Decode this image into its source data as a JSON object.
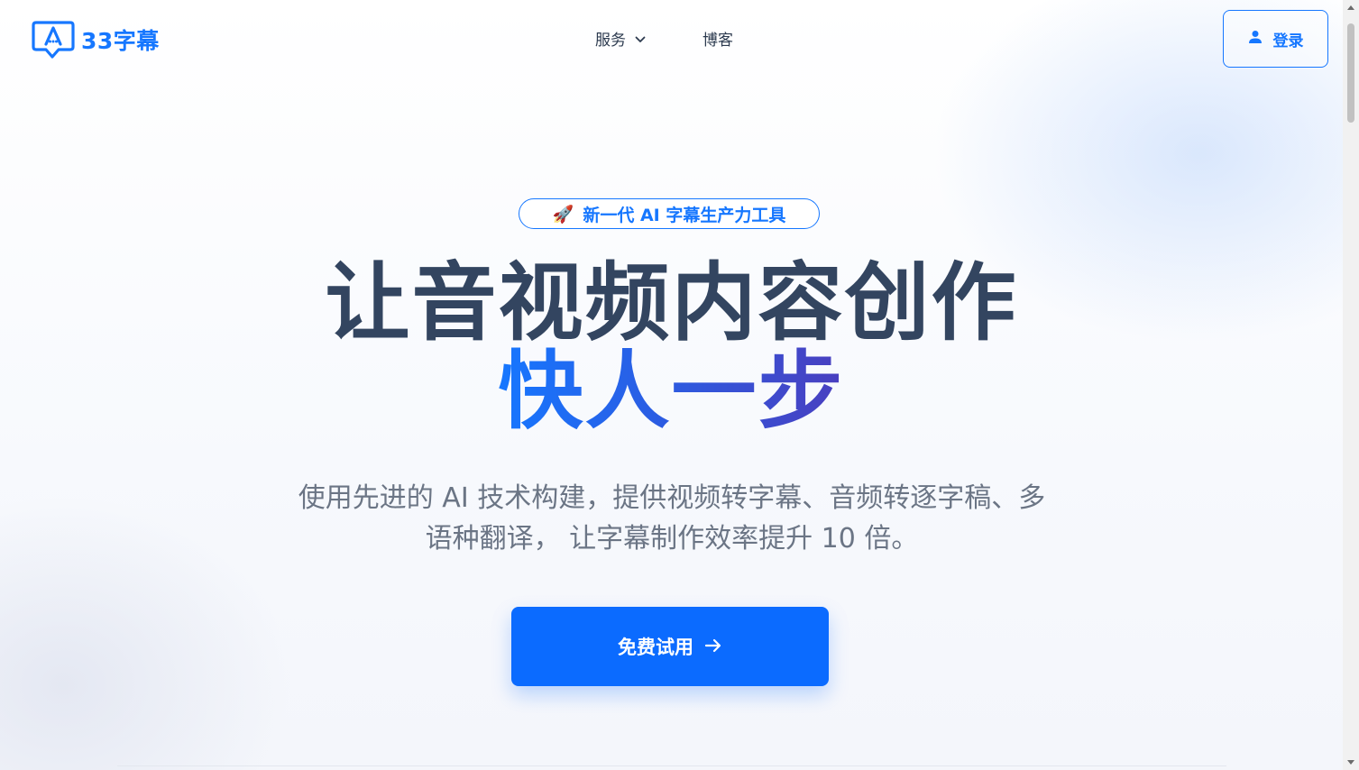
{
  "header": {
    "logo_text": "33字幕",
    "nav": [
      {
        "label": "服务",
        "has_dropdown": true
      },
      {
        "label": "博客",
        "has_dropdown": false
      }
    ],
    "login_label": "登录",
    "icons": {
      "logo": "subtitle-bubble-icon",
      "login": "user-icon",
      "dropdown": "chevron-down-icon"
    }
  },
  "hero": {
    "badge_icon": "🚀",
    "badge_text": "新一代 AI 字幕生产力工具",
    "headline_line1": "让音视频内容创作",
    "headline_line2": "快人一步",
    "subtitle_line1": "使用先进的 AI 技术构建，提供视频转字幕、音频转逐字稿、多",
    "subtitle_line2": "语种翻译， 让字幕制作效率提升 10 倍。",
    "cta_label": "免费试用",
    "cta_icon": "arrow-right-icon"
  },
  "colors": {
    "primary": "#1677ff",
    "cta": "#0b6bff",
    "heading": "#334560",
    "subtitle": "#6b7585",
    "gradient_end": "#4a3fbf"
  }
}
